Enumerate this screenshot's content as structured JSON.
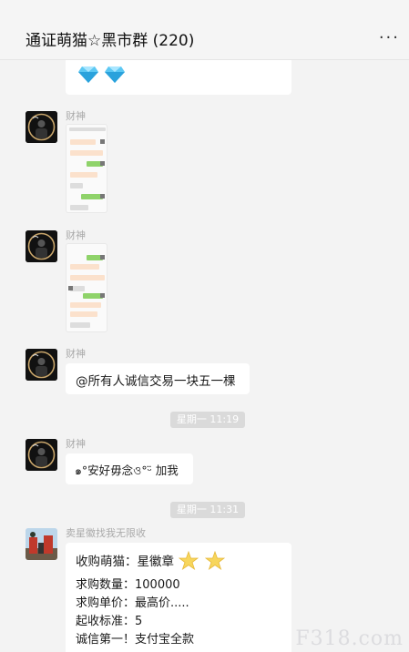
{
  "header": {
    "title": "通证萌猫☆黑市群 (220)",
    "more_label": "..."
  },
  "messages": {
    "m2_sender": "财神",
    "m3_sender": "财神",
    "m4_sender": "财神",
    "m4_text": "@所有人诚信交易一块五一棵",
    "time1": "星期一 11:19",
    "m5_sender": "财神",
    "m5_text": "๑°安好毋念ও°ᵕ̈ 加我",
    "time2": "星期一 11:31",
    "m6_sender": "卖星徽找我无限收",
    "m6_lines": [
      "收购萌猫：星徽章",
      "求购数量：100000",
      "求购单价：最高价.....",
      "起收标准：5",
      "诚信第一！支付宝全款"
    ]
  },
  "watermark": "F318.com",
  "colors": {
    "accent_green": "#8fd36a",
    "bubble": "#ffffff",
    "bg": "#f3f3f3"
  },
  "icons": [
    "diamond-icon",
    "star-badge-icon"
  ]
}
